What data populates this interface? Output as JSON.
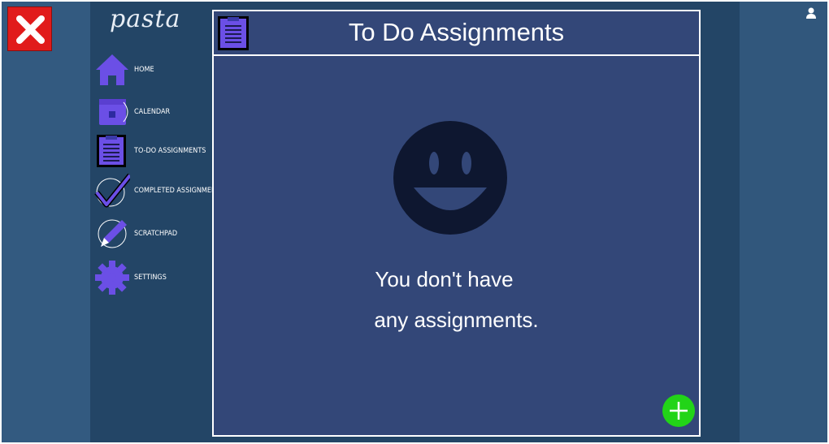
{
  "app": {
    "logo_text": "pasta"
  },
  "window": {
    "close_icon": "close-icon",
    "user_icon": "user-icon"
  },
  "sidebar": {
    "items": [
      {
        "label": "HOME",
        "icon": "home-icon"
      },
      {
        "label": "CALENDAR",
        "icon": "calendar-icon"
      },
      {
        "label": "TO-DO ASSIGNMENTS",
        "icon": "clipboard-icon"
      },
      {
        "label": "COMPLETED ASSIGNMENTS",
        "icon": "checkmark-icon"
      },
      {
        "label": "SCRATCHPAD",
        "icon": "pencil-icon"
      },
      {
        "label": "SETTINGS",
        "icon": "gear-icon"
      }
    ]
  },
  "main": {
    "title": "To Do Assignments",
    "header_icon": "clipboard-icon",
    "empty_icon": "smiley-face-icon",
    "empty_line1": "You don't have",
    "empty_line2": "any assignments.",
    "add_icon": "plus-icon"
  },
  "colors": {
    "close_red": "#e11b1b",
    "nav_purple": "#6b4fe6",
    "card_bg": "#334778",
    "add_green": "#22d418"
  }
}
